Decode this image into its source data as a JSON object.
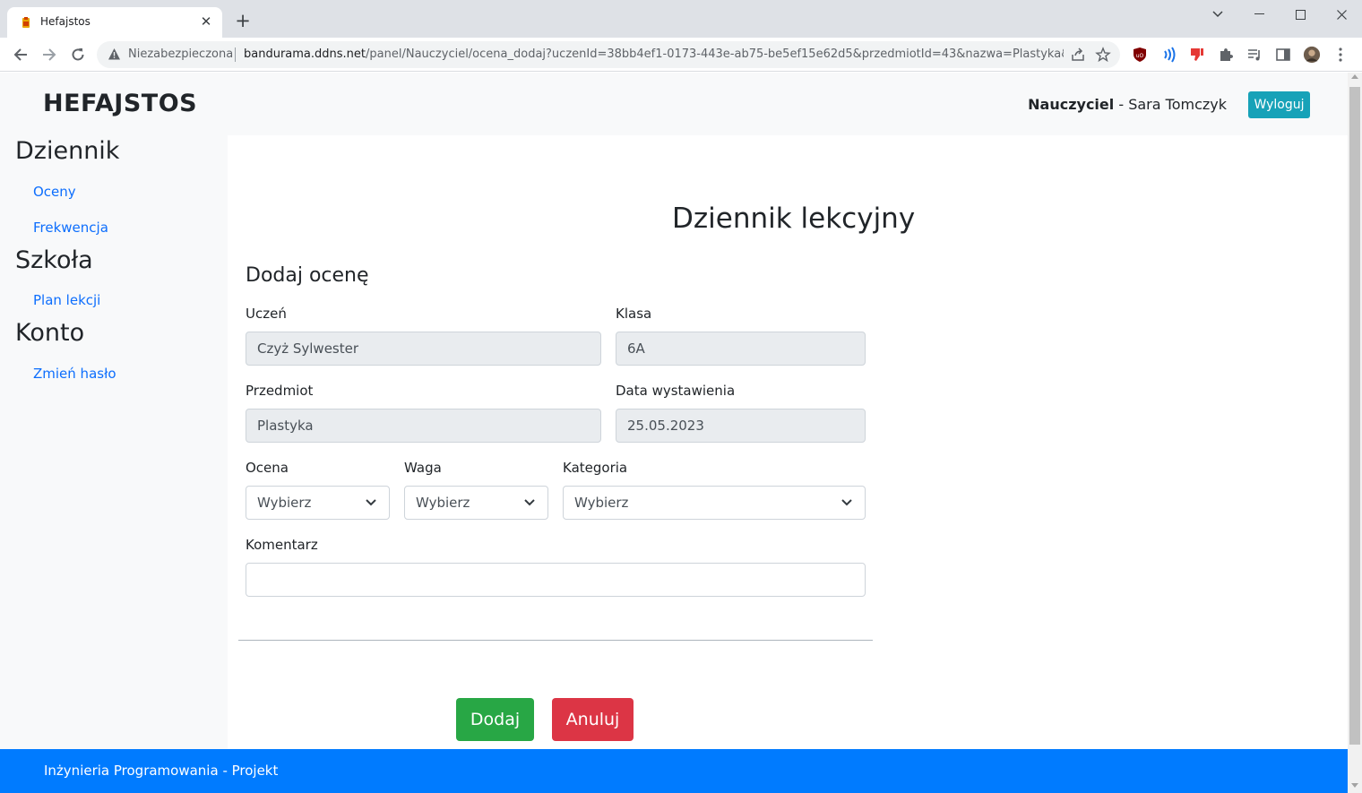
{
  "browser": {
    "tab_title": "Hefajstos",
    "security_label": "Niezabezpieczona",
    "url_host": "bandurama.ddns.net",
    "url_path": "/panel/Nauczyciel/ocena_dodaj?uczenId=38bb4ef1-0173-443e-ab75-be5ef15e62d5&przedmiotId=43&nazwa=Plastyka&klas..."
  },
  "header": {
    "brand": "HEFAJSTOS",
    "role": "Nauczyciel",
    "user_sep": " - ",
    "user_name": "Sara Tomczyk",
    "logout_label": "Wyloguj"
  },
  "sidebar": {
    "sections": [
      {
        "heading": "Dziennik",
        "links": [
          "Oceny",
          "Frekwencja"
        ]
      },
      {
        "heading": "Szkoła",
        "links": [
          "Plan lekcji"
        ]
      },
      {
        "heading": "Konto",
        "links": [
          "Zmień hasło"
        ]
      }
    ]
  },
  "main": {
    "title": "Dziennik lekcyjny",
    "form_title": "Dodaj ocenę",
    "fields": {
      "student": {
        "label": "Uczeń",
        "value": "Czyż Sylwester"
      },
      "class": {
        "label": "Klasa",
        "value": "6A"
      },
      "subject": {
        "label": "Przedmiot",
        "value": "Plastyka"
      },
      "date": {
        "label": "Data wystawienia",
        "value": "25.05.2023"
      },
      "grade": {
        "label": "Ocena",
        "value": "Wybierz"
      },
      "weight": {
        "label": "Waga",
        "value": "Wybierz"
      },
      "category": {
        "label": "Kategoria",
        "value": "Wybierz"
      },
      "comment": {
        "label": "Komentarz",
        "value": ""
      }
    },
    "add_label": "Dodaj",
    "cancel_label": "Anuluj"
  },
  "footer": {
    "text": "Inżynieria Programowania - Projekt"
  },
  "colors": {
    "primary": "#007bff",
    "info": "#17a2b8",
    "success": "#28a745",
    "danger": "#dc3545"
  }
}
